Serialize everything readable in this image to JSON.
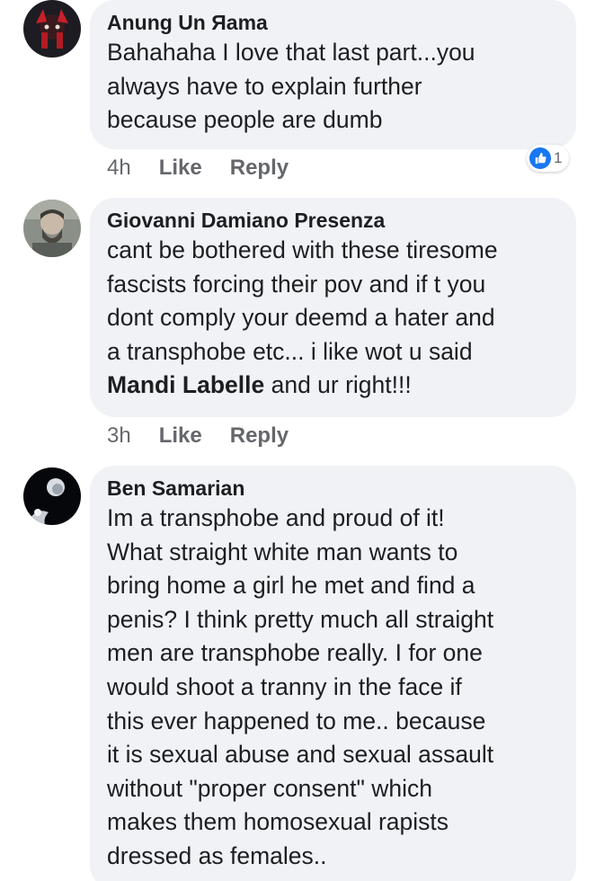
{
  "comments": [
    {
      "author": "Anung Un Яama",
      "lines": [
        "Bahahaha I love that last part...you",
        "always have to explain further",
        "because people are dumb"
      ],
      "time": "4h",
      "like_label": "Like",
      "reply_label": "Reply",
      "reaction_count": "1"
    },
    {
      "author": "Giovanni Damiano Presenza",
      "lines": [
        "cant be bothered with these tiresome",
        "fascists forcing their pov and if  t you",
        "dont comply your deemd a hater and",
        "a transphobe etc... i like wot u said"
      ],
      "mention": "Mandi Labelle",
      "mention_tail": " and ur right!!!",
      "time": "3h",
      "like_label": "Like",
      "reply_label": "Reply"
    },
    {
      "author": "Ben Samarian",
      "lines": [
        "Im a transphobe and proud of it!",
        "What straight white man wants to",
        "bring home a girl he met and find a",
        "penis? I think pretty much all straight",
        "men are transphobe really. I for one",
        "would shoot a tranny in the face if",
        "this ever happened to me.. because",
        "it is sexual abuse and sexual assault",
        "without \"proper consent\" which",
        "makes them homosexual rapists",
        "dressed as females.."
      ]
    }
  ],
  "colors": {
    "bubble_bg": "#f0f2f5",
    "meta_text": "#65676b",
    "like_badge": "#1877f2"
  }
}
